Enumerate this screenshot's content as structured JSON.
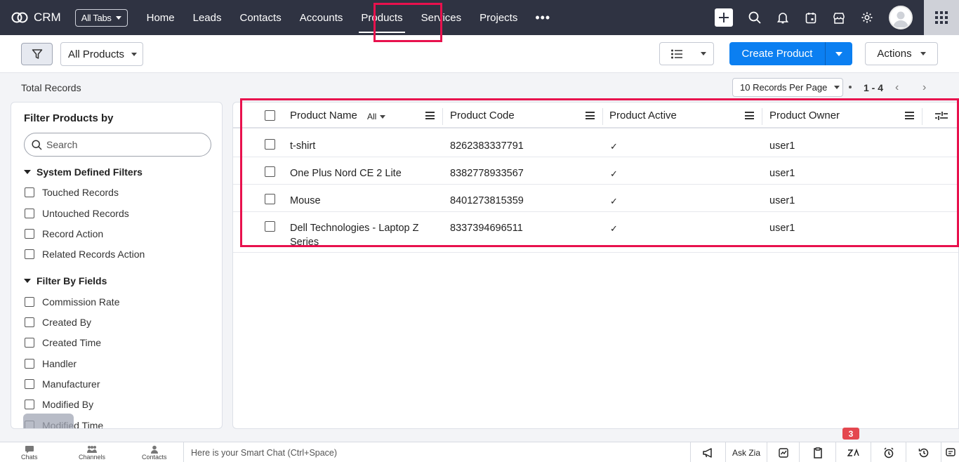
{
  "app": {
    "name": "CRM",
    "all_tabs_label": "All Tabs"
  },
  "nav": {
    "items": [
      {
        "label": "Home"
      },
      {
        "label": "Leads"
      },
      {
        "label": "Contacts"
      },
      {
        "label": "Accounts"
      },
      {
        "label": "Products"
      },
      {
        "label": "Services"
      },
      {
        "label": "Projects"
      }
    ],
    "more_label": "•••",
    "active": "Products"
  },
  "toolbar": {
    "view_label": "All Products",
    "create_label": "Create Product",
    "actions_label": "Actions"
  },
  "records": {
    "total_label": "Total Records",
    "per_page_label": "10 Records Per Page",
    "range": "1 - 4",
    "prev_glyph": "‹",
    "next_glyph": "›"
  },
  "filters": {
    "title": "Filter Products by",
    "search_placeholder": "Search",
    "system_section": "System Defined Filters",
    "system_items": [
      "Touched Records",
      "Untouched Records",
      "Record Action",
      "Related Records Action"
    ],
    "fields_section": "Filter By Fields",
    "field_items": [
      "Commission Rate",
      "Created By",
      "Created Time",
      "Handler",
      "Manufacturer",
      "Modified By",
      "Modified Time"
    ]
  },
  "table": {
    "columns": [
      "Product Name",
      "Product Code",
      "Product Active",
      "Product Owner"
    ],
    "name_filter_label": "All",
    "check_glyph": "✓",
    "rows": [
      {
        "name": "t-shirt",
        "code": "8262383337791",
        "owner": "user1"
      },
      {
        "name": "One Plus Nord CE 2 Lite",
        "code": "8382778933567",
        "owner": "user1"
      },
      {
        "name": "Mouse",
        "code": "8401273815359",
        "owner": "user1"
      },
      {
        "name": "Dell Technologies - Laptop Z Series",
        "code": "8337394696511",
        "owner": "user1"
      }
    ]
  },
  "bottombar": {
    "chats": "Chats",
    "channels": "Channels",
    "contacts": "Contacts",
    "chat_placeholder": "Here is your Smart Chat (Ctrl+Space)",
    "ask_zia": "Ask Zia",
    "badge_count": "3"
  },
  "colors": {
    "nav_bg": "#2f3342",
    "primary": "#0b7ff1",
    "highlight": "#e8114d",
    "badge": "#e4474f"
  }
}
